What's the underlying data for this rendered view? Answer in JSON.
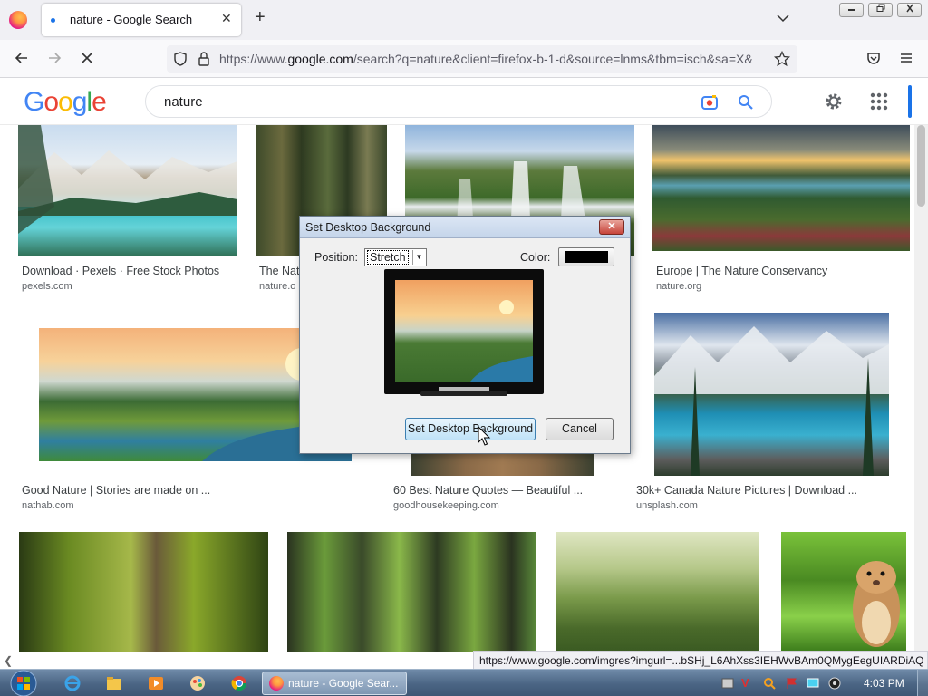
{
  "browser": {
    "tab_title": "nature - Google Search",
    "tab_close": "✕",
    "new_tab": "+",
    "url_prefix": "https://www.",
    "url_domain": "google.com",
    "url_rest": "/search?q=nature&client=firefox-b-1-d&source=lnms&tbm=isch&sa=X&"
  },
  "google": {
    "logo_letters": [
      "G",
      "o",
      "o",
      "g",
      "l",
      "e"
    ],
    "logo_colors": [
      "#4285f4",
      "#ea4335",
      "#fbbc05",
      "#4285f4",
      "#34a853",
      "#ea4335"
    ],
    "query": "nature"
  },
  "results": [
    {
      "caption": "Download · Pexels · Free Stock Photos",
      "source": "pexels.com"
    },
    {
      "caption": "The Nat",
      "source": "nature.o"
    },
    {
      "caption": "Europe | The Nature Conservancy",
      "source": "nature.org"
    },
    {
      "caption": "Good Nature | Stories are made on ...",
      "source": "nathab.com"
    },
    {
      "caption": "60 Best Nature Quotes — Beautiful ...",
      "source": "goodhousekeeping.com"
    },
    {
      "caption": "30k+ Canada Nature Pictures | Download ...",
      "source": "unsplash.com"
    }
  ],
  "dialog": {
    "title": "Set Desktop Background",
    "close": "✕",
    "position_label": "Position:",
    "position_value": "Stretch",
    "color_label": "Color:",
    "color_value": "#000000",
    "set_button": "Set Desktop Background",
    "cancel_button": "Cancel"
  },
  "status_url": "https://www.google.com/imgres?imgurl=...bSHj_L6AhXss3IEHWvBAm0QMygEegUIARDiAQ",
  "taskbar": {
    "active_task": "nature - Google Sear...",
    "clock": "4:03 PM"
  }
}
